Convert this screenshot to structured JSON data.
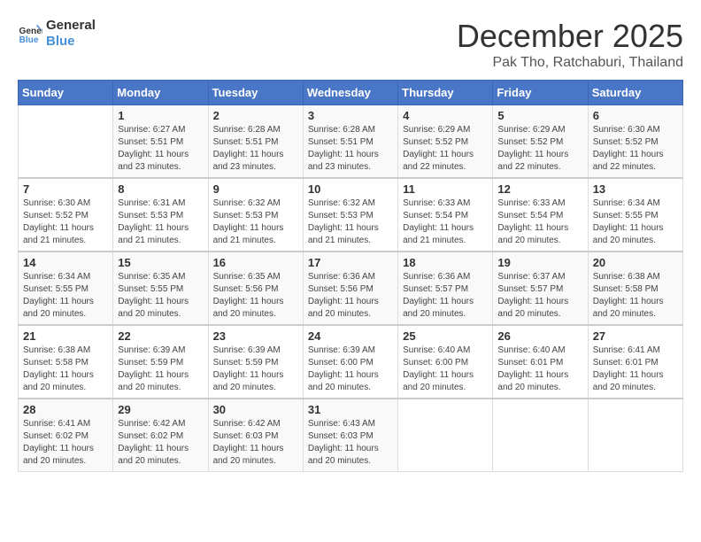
{
  "logo": {
    "text_general": "General",
    "text_blue": "Blue"
  },
  "title": "December 2025",
  "subtitle": "Pak Tho, Ratchaburi, Thailand",
  "header_days": [
    "Sunday",
    "Monday",
    "Tuesday",
    "Wednesday",
    "Thursday",
    "Friday",
    "Saturday"
  ],
  "weeks": [
    [
      {
        "day": "",
        "sunrise": "",
        "sunset": "",
        "daylight": ""
      },
      {
        "day": "1",
        "sunrise": "Sunrise: 6:27 AM",
        "sunset": "Sunset: 5:51 PM",
        "daylight": "Daylight: 11 hours and 23 minutes."
      },
      {
        "day": "2",
        "sunrise": "Sunrise: 6:28 AM",
        "sunset": "Sunset: 5:51 PM",
        "daylight": "Daylight: 11 hours and 23 minutes."
      },
      {
        "day": "3",
        "sunrise": "Sunrise: 6:28 AM",
        "sunset": "Sunset: 5:51 PM",
        "daylight": "Daylight: 11 hours and 23 minutes."
      },
      {
        "day": "4",
        "sunrise": "Sunrise: 6:29 AM",
        "sunset": "Sunset: 5:52 PM",
        "daylight": "Daylight: 11 hours and 22 minutes."
      },
      {
        "day": "5",
        "sunrise": "Sunrise: 6:29 AM",
        "sunset": "Sunset: 5:52 PM",
        "daylight": "Daylight: 11 hours and 22 minutes."
      },
      {
        "day": "6",
        "sunrise": "Sunrise: 6:30 AM",
        "sunset": "Sunset: 5:52 PM",
        "daylight": "Daylight: 11 hours and 22 minutes."
      }
    ],
    [
      {
        "day": "7",
        "sunrise": "Sunrise: 6:30 AM",
        "sunset": "Sunset: 5:52 PM",
        "daylight": "Daylight: 11 hours and 21 minutes."
      },
      {
        "day": "8",
        "sunrise": "Sunrise: 6:31 AM",
        "sunset": "Sunset: 5:53 PM",
        "daylight": "Daylight: 11 hours and 21 minutes."
      },
      {
        "day": "9",
        "sunrise": "Sunrise: 6:32 AM",
        "sunset": "Sunset: 5:53 PM",
        "daylight": "Daylight: 11 hours and 21 minutes."
      },
      {
        "day": "10",
        "sunrise": "Sunrise: 6:32 AM",
        "sunset": "Sunset: 5:53 PM",
        "daylight": "Daylight: 11 hours and 21 minutes."
      },
      {
        "day": "11",
        "sunrise": "Sunrise: 6:33 AM",
        "sunset": "Sunset: 5:54 PM",
        "daylight": "Daylight: 11 hours and 21 minutes."
      },
      {
        "day": "12",
        "sunrise": "Sunrise: 6:33 AM",
        "sunset": "Sunset: 5:54 PM",
        "daylight": "Daylight: 11 hours and 20 minutes."
      },
      {
        "day": "13",
        "sunrise": "Sunrise: 6:34 AM",
        "sunset": "Sunset: 5:55 PM",
        "daylight": "Daylight: 11 hours and 20 minutes."
      }
    ],
    [
      {
        "day": "14",
        "sunrise": "Sunrise: 6:34 AM",
        "sunset": "Sunset: 5:55 PM",
        "daylight": "Daylight: 11 hours and 20 minutes."
      },
      {
        "day": "15",
        "sunrise": "Sunrise: 6:35 AM",
        "sunset": "Sunset: 5:55 PM",
        "daylight": "Daylight: 11 hours and 20 minutes."
      },
      {
        "day": "16",
        "sunrise": "Sunrise: 6:35 AM",
        "sunset": "Sunset: 5:56 PM",
        "daylight": "Daylight: 11 hours and 20 minutes."
      },
      {
        "day": "17",
        "sunrise": "Sunrise: 6:36 AM",
        "sunset": "Sunset: 5:56 PM",
        "daylight": "Daylight: 11 hours and 20 minutes."
      },
      {
        "day": "18",
        "sunrise": "Sunrise: 6:36 AM",
        "sunset": "Sunset: 5:57 PM",
        "daylight": "Daylight: 11 hours and 20 minutes."
      },
      {
        "day": "19",
        "sunrise": "Sunrise: 6:37 AM",
        "sunset": "Sunset: 5:57 PM",
        "daylight": "Daylight: 11 hours and 20 minutes."
      },
      {
        "day": "20",
        "sunrise": "Sunrise: 6:38 AM",
        "sunset": "Sunset: 5:58 PM",
        "daylight": "Daylight: 11 hours and 20 minutes."
      }
    ],
    [
      {
        "day": "21",
        "sunrise": "Sunrise: 6:38 AM",
        "sunset": "Sunset: 5:58 PM",
        "daylight": "Daylight: 11 hours and 20 minutes."
      },
      {
        "day": "22",
        "sunrise": "Sunrise: 6:39 AM",
        "sunset": "Sunset: 5:59 PM",
        "daylight": "Daylight: 11 hours and 20 minutes."
      },
      {
        "day": "23",
        "sunrise": "Sunrise: 6:39 AM",
        "sunset": "Sunset: 5:59 PM",
        "daylight": "Daylight: 11 hours and 20 minutes."
      },
      {
        "day": "24",
        "sunrise": "Sunrise: 6:39 AM",
        "sunset": "Sunset: 6:00 PM",
        "daylight": "Daylight: 11 hours and 20 minutes."
      },
      {
        "day": "25",
        "sunrise": "Sunrise: 6:40 AM",
        "sunset": "Sunset: 6:00 PM",
        "daylight": "Daylight: 11 hours and 20 minutes."
      },
      {
        "day": "26",
        "sunrise": "Sunrise: 6:40 AM",
        "sunset": "Sunset: 6:01 PM",
        "daylight": "Daylight: 11 hours and 20 minutes."
      },
      {
        "day": "27",
        "sunrise": "Sunrise: 6:41 AM",
        "sunset": "Sunset: 6:01 PM",
        "daylight": "Daylight: 11 hours and 20 minutes."
      }
    ],
    [
      {
        "day": "28",
        "sunrise": "Sunrise: 6:41 AM",
        "sunset": "Sunset: 6:02 PM",
        "daylight": "Daylight: 11 hours and 20 minutes."
      },
      {
        "day": "29",
        "sunrise": "Sunrise: 6:42 AM",
        "sunset": "Sunset: 6:02 PM",
        "daylight": "Daylight: 11 hours and 20 minutes."
      },
      {
        "day": "30",
        "sunrise": "Sunrise: 6:42 AM",
        "sunset": "Sunset: 6:03 PM",
        "daylight": "Daylight: 11 hours and 20 minutes."
      },
      {
        "day": "31",
        "sunrise": "Sunrise: 6:43 AM",
        "sunset": "Sunset: 6:03 PM",
        "daylight": "Daylight: 11 hours and 20 minutes."
      },
      {
        "day": "",
        "sunrise": "",
        "sunset": "",
        "daylight": ""
      },
      {
        "day": "",
        "sunrise": "",
        "sunset": "",
        "daylight": ""
      },
      {
        "day": "",
        "sunrise": "",
        "sunset": "",
        "daylight": ""
      }
    ]
  ]
}
